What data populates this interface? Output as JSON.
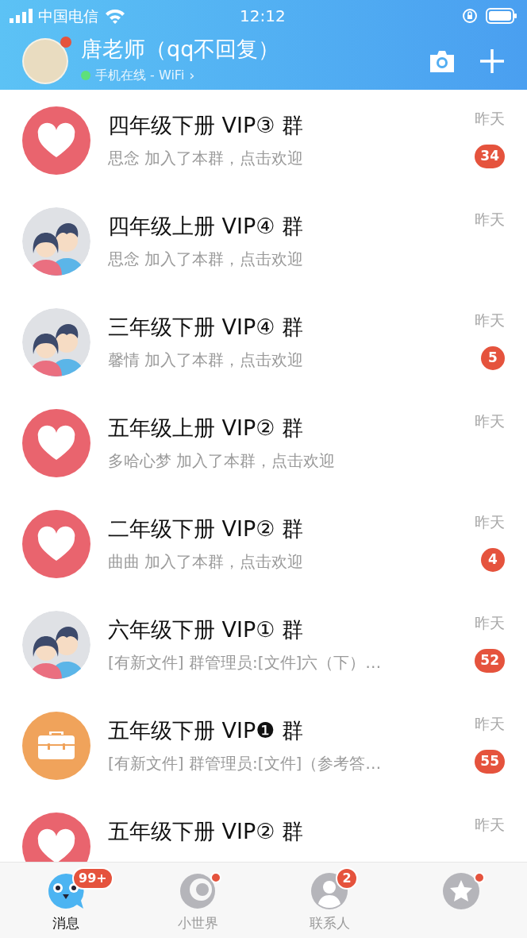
{
  "status_bar": {
    "carrier": "中国电信",
    "time": "12:12"
  },
  "header": {
    "name": "唐老师（qq不回复）",
    "online_status": "手机在线 - WiFi",
    "chevron": "›",
    "has_notification": true
  },
  "conversations": [
    {
      "kind": "heart",
      "title": "四年级下册 VIP③ 群",
      "preview": "思念 加入了本群，点击欢迎",
      "time": "昨天",
      "badge": "34"
    },
    {
      "kind": "couple",
      "title": "四年级上册 VIP④ 群",
      "preview": "思念 加入了本群，点击欢迎",
      "time": "昨天"
    },
    {
      "kind": "couple",
      "title": "三年级下册 VIP④ 群",
      "preview": "馨情 加入了本群，点击欢迎",
      "time": "昨天",
      "badge": "5"
    },
    {
      "kind": "heart",
      "title": "五年级上册 VIP② 群",
      "preview": "多哈心梦 加入了本群，点击欢迎",
      "time": "昨天"
    },
    {
      "kind": "heart",
      "title": "二年级下册 VIP② 群",
      "preview": "曲曲 加入了本群，点击欢迎",
      "time": "昨天",
      "badge": "4"
    },
    {
      "kind": "couple",
      "title": "六年级下册 VIP① 群",
      "preview": "[有新文件] 群管理员:[文件]六（下）…",
      "time": "昨天",
      "badge": "52"
    },
    {
      "kind": "briefcase",
      "title": "五年级下册 VIP❶ 群",
      "preview": "[有新文件] 群管理员:[文件]（参考答…",
      "time": "昨天",
      "badge": "55"
    },
    {
      "kind": "heart",
      "title": "五年级下册 VIP② 群",
      "time": "昨天"
    }
  ],
  "tab_bar": [
    {
      "kind": "messages",
      "label": "消息",
      "selected": true,
      "badge": "99+"
    },
    {
      "kind": "world",
      "label": "小世界",
      "selected": false,
      "dot": true
    },
    {
      "kind": "contacts",
      "label": "联系人",
      "selected": false,
      "badge": "2"
    },
    {
      "kind": "feed",
      "selected": false,
      "dot": true
    }
  ]
}
